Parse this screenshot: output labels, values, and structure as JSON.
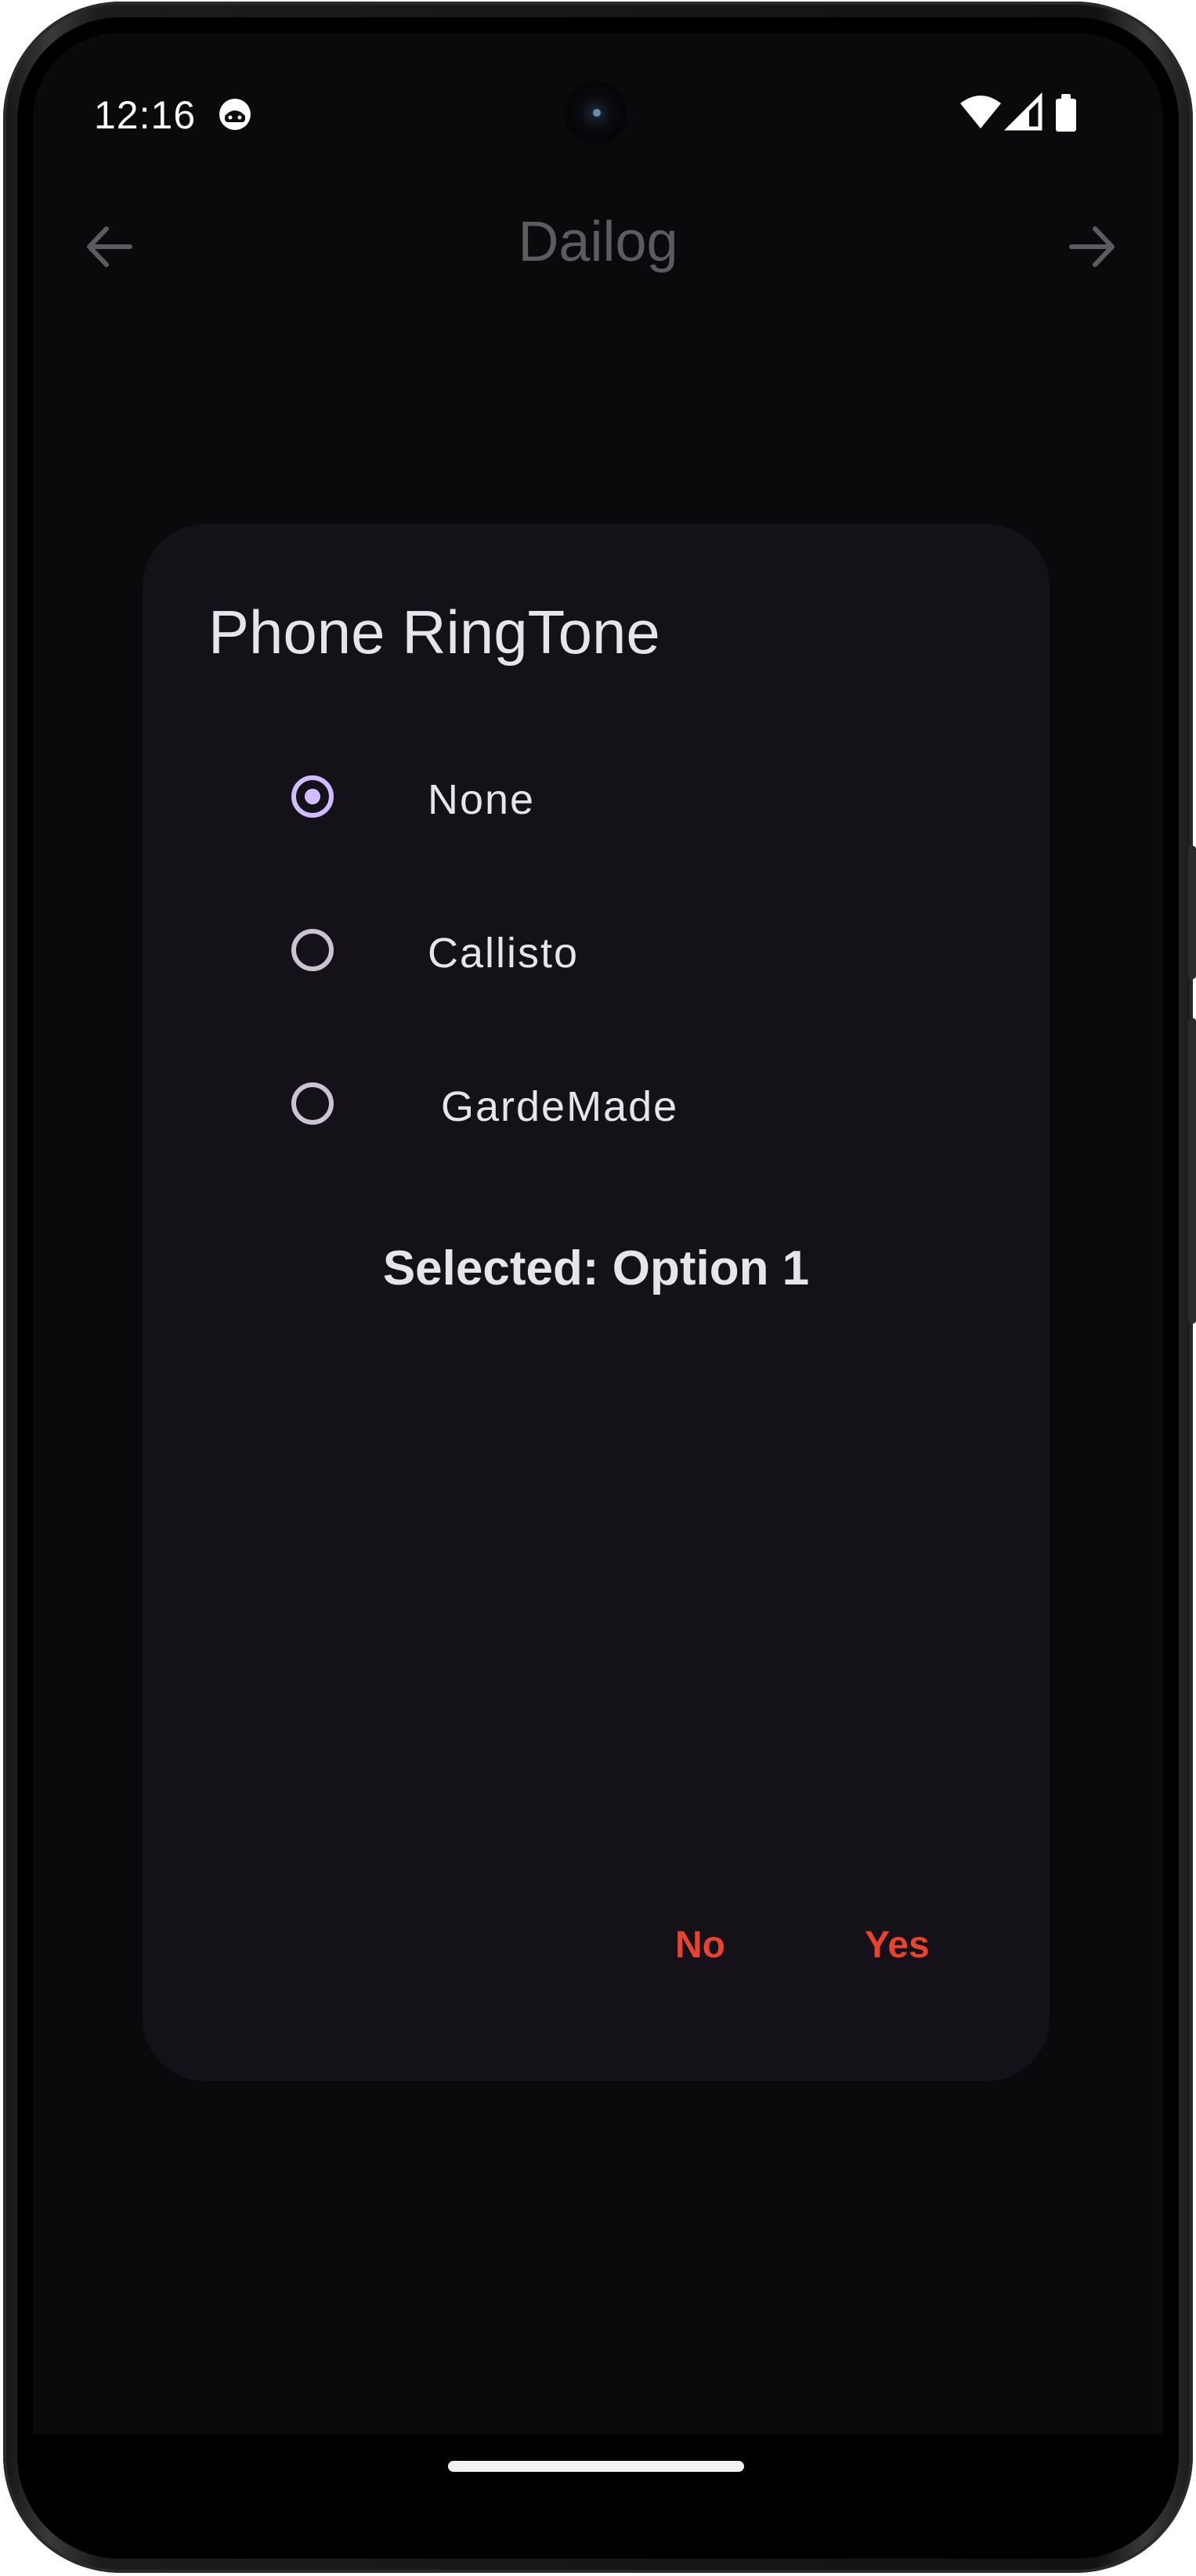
{
  "status_bar": {
    "time": "12:16",
    "icons": [
      "android-face-icon",
      "wifi-icon",
      "signal-icon",
      "battery-icon"
    ]
  },
  "app_bar": {
    "title": "Dailog",
    "back_icon": "arrow-left-icon",
    "forward_icon": "arrow-right-icon"
  },
  "dialog": {
    "title": "Phone RingTone",
    "options": [
      {
        "label": "None",
        "selected": true
      },
      {
        "label": "Callisto",
        "selected": false
      },
      {
        "label": " GardeMade",
        "selected": false
      }
    ],
    "selected_text": "Selected: Option 1",
    "buttons": {
      "no": "No",
      "yes": "Yes"
    }
  },
  "colors": {
    "screen_background": "#0a0a0c",
    "dialog_background": "#141218",
    "radio_selected": "#d0bcff",
    "radio_unselected": "#cac4d0",
    "button_text": "#e94330",
    "title_text": "#5c5c60"
  }
}
